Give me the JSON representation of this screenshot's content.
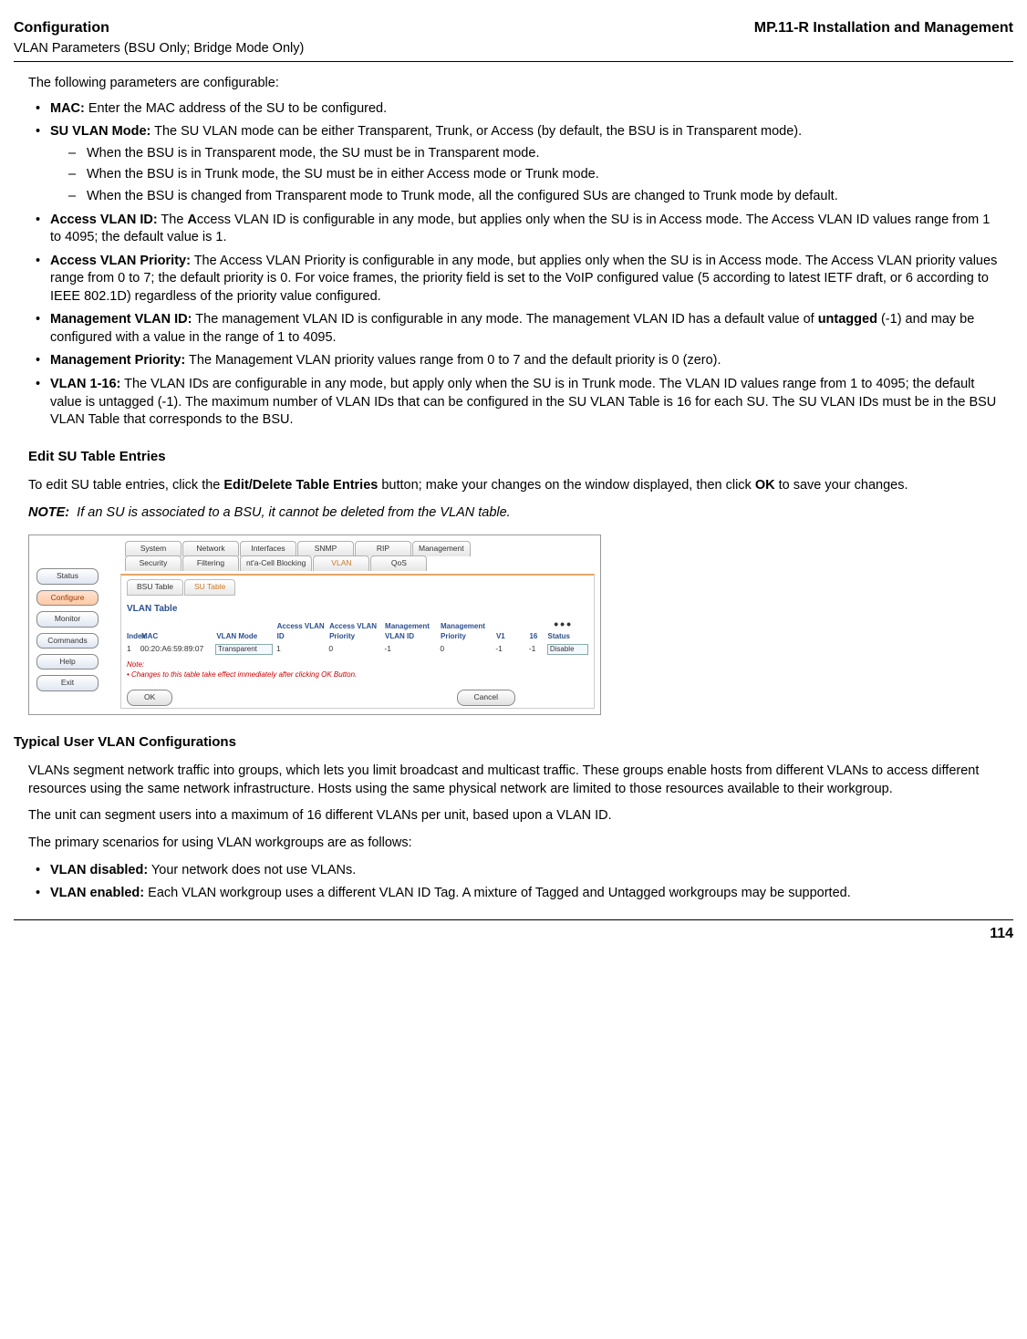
{
  "header": {
    "left_title": "Configuration",
    "left_sub": "VLAN Parameters (BSU Only; Bridge Mode Only)",
    "right_title": "MP.11-R Installation and Management"
  },
  "intro": "The following parameters are configurable:",
  "params": {
    "mac": {
      "label": "MAC:",
      "text": " Enter the MAC address of the SU to be configured."
    },
    "su_vlan_mode": {
      "label": "SU VLAN Mode:",
      "text": " The SU VLAN mode can be either Transparent, Trunk, or Access (by default, the BSU is in Transparent mode).",
      "dashes": [
        "When the BSU is in Transparent mode, the SU must be in Transparent mode.",
        "When the BSU is in Trunk mode, the SU must be in either Access mode or Trunk mode.",
        "When the BSU is changed from Transparent mode to Trunk mode, all the configured SUs are changed to Trunk mode by default."
      ]
    },
    "access_vlan_id": {
      "label": "Access VLAN ID:",
      "pre": " The ",
      "bold_mid": "A",
      "text": "ccess VLAN ID is configurable in any mode, but applies only when the SU is in Access mode. The Access VLAN ID values range from 1 to 4095; the default value is 1."
    },
    "access_vlan_priority": {
      "label": "Access VLAN Priority:",
      "text": " The Access VLAN Priority is configurable in any mode, but applies only when the SU is in Access mode. The Access VLAN priority values range from 0 to 7; the default priority is 0. For voice frames, the priority field is set to the VoIP configured value (5 according to latest IETF draft, or 6 according to IEEE 802.1D) regardless of the priority value configured."
    },
    "mgmt_vlan_id": {
      "label": "Management VLAN ID:",
      "pre": " The management VLAN ID is configurable in any mode. The management VLAN ID has a default value of ",
      "bold_mid": "untagged",
      "post": " (-1) and may be configured with a value in the range of 1 to 4095."
    },
    "mgmt_priority": {
      "label": "Management Priority:",
      "text": " The Management VLAN priority values range from 0 to 7 and the default priority is 0 (zero)."
    },
    "vlan_1_16": {
      "label": "VLAN 1-16:",
      "text": " The VLAN IDs are configurable in any mode, but apply only when the SU is in Trunk mode. The VLAN ID values range from 1 to 4095; the default value is untagged (-1). The maximum number of VLAN IDs that can be configured in the SU VLAN Table is 16 for each SU. The SU VLAN IDs must be in the BSU VLAN Table that corresponds to the BSU."
    }
  },
  "edit_section": {
    "heading": "Edit SU Table Entries",
    "p1_pre": "To edit SU table entries, click the ",
    "p1_b1": "Edit/Delete Table Entries",
    "p1_mid": " button; make your changes on the window displayed, then click ",
    "p1_b2": "OK",
    "p1_post": " to save your changes.",
    "note_label": "NOTE:",
    "note_text": "If an SU is associated to a BSU, it cannot be deleted from the VLAN table."
  },
  "ui": {
    "top_tabs": [
      "System",
      "Network",
      "Interfaces",
      "SNMP",
      "RIP",
      "Management"
    ],
    "row2_tabs": [
      "Security",
      "Filtering",
      "nt'a-Cell Blocking",
      "VLAN",
      "QoS"
    ],
    "row2_active": "VLAN",
    "sidebar": [
      "Status",
      "Configure",
      "Monitor",
      "Commands",
      "Help",
      "Exit"
    ],
    "sidebar_active": "Configure",
    "sub_tabs": [
      "BSU Table",
      "SU Table"
    ],
    "sub_active": "SU Table",
    "panel_title": "VLAN Table",
    "headers": {
      "idx": "Index",
      "mac": "MAC",
      "mode": "VLAN Mode",
      "avid": "Access VLAN ID",
      "avp": "Access VLAN Priority",
      "mvid": "Management VLAN ID",
      "mvp": "Management Priority",
      "v1": "V1",
      "v16": "16",
      "status": "Status"
    },
    "row": {
      "idx": "1",
      "mac": "00:20:A6:59:89:07",
      "mode": "Transparent",
      "avid": "1",
      "avp": "0",
      "mvid": "-1",
      "mvp": "0",
      "v1": "-1",
      "v16": "-1",
      "status": "Disable"
    },
    "note_title": "Note:",
    "note_body": "•   Changes to this table take effect immediately after clicking OK Button.",
    "ok": "OK",
    "cancel": "Cancel",
    "dots": "•••"
  },
  "typical_section": {
    "heading": "Typical User VLAN Configurations",
    "p1": "VLANs segment network traffic into groups, which lets you limit broadcast and multicast traffic. These groups enable hosts from different VLANs to access different resources using the same network infrastructure. Hosts using the same physical network are limited to those resources available to their workgroup.",
    "p2": "The unit can segment users into a maximum of 16 different VLANs per unit, based upon a VLAN ID.",
    "p3": "The primary scenarios for using VLAN workgroups are as follows:",
    "bullets": {
      "disabled": {
        "label": "VLAN disabled:",
        "text": " Your network does not use VLANs."
      },
      "enabled": {
        "label": "VLAN enabled:",
        "text": " Each VLAN workgroup uses a different VLAN ID Tag. A mixture of Tagged and Untagged workgroups may be supported."
      }
    }
  },
  "page_number": "114"
}
